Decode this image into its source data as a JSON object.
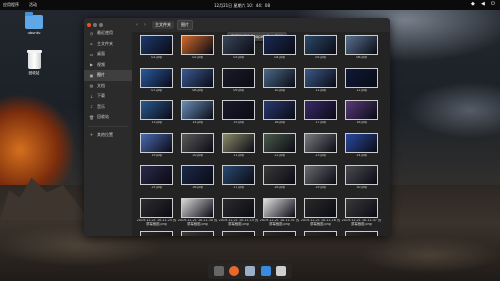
{
  "topbar": {
    "apps_menu": "应用程序",
    "activities": "活动",
    "clock": "12月21日 星期六 10：44：08"
  },
  "desktop": {
    "home_label": "ubuntu",
    "trash_label": "回收站"
  },
  "window": {
    "breadcrumb_home": "主文件夹",
    "breadcrumb_current": "图片",
    "toast_text": "已删除\"Wallpapers\"",
    "toast_undo": "撤消"
  },
  "sidebar": {
    "items": [
      {
        "icon": "clock-icon",
        "label": "最近使用"
      },
      {
        "icon": "home-icon",
        "label": "主文件夹"
      },
      {
        "icon": "desktop-icon",
        "label": "桌面"
      },
      {
        "icon": "video-icon",
        "label": "视频"
      },
      {
        "icon": "image-icon",
        "label": "图片"
      },
      {
        "icon": "document-icon",
        "label": "文档"
      },
      {
        "icon": "download-icon",
        "label": "下载"
      },
      {
        "icon": "music-icon",
        "label": "音乐"
      },
      {
        "icon": "trash-icon",
        "label": "回收站"
      }
    ],
    "other_locations": "其他位置"
  },
  "files": [
    {
      "name": "01.jpg",
      "color": "#1d3a6e"
    },
    {
      "name": "02.jpg",
      "color": "#d06a2a"
    },
    {
      "name": "03.jpg",
      "color": "#3a4658"
    },
    {
      "name": "04.jpg",
      "color": "#1a2a52"
    },
    {
      "name": "05.jpg",
      "color": "#2a4a6a"
    },
    {
      "name": "06.jpg",
      "color": "#5a7290"
    },
    {
      "name": "07.jpg",
      "color": "#2a5aa0"
    },
    {
      "name": "08.jpg",
      "color": "#3a5a92"
    },
    {
      "name": "09.jpg",
      "color": "#1c1c2a"
    },
    {
      "name": "10.jpg",
      "color": "#4a6a88"
    },
    {
      "name": "11.jpg",
      "color": "#3a5a88"
    },
    {
      "name": "12.jpg",
      "color": "#0e1a3a"
    },
    {
      "name": "13.jpg",
      "color": "#2a5a90"
    },
    {
      "name": "14.jpg",
      "color": "#6a8eb8"
    },
    {
      "name": "15.jpg",
      "color": "#1a1a2a"
    },
    {
      "name": "16.jpg",
      "color": "#2a3a70"
    },
    {
      "name": "17.jpg",
      "color": "#3a2a6a"
    },
    {
      "name": "18.jpg",
      "color": "#5a3a7a"
    },
    {
      "name": "19.jpg",
      "color": "#4a6ab0"
    },
    {
      "name": "20.jpg",
      "color": "#5a5a5a"
    },
    {
      "name": "21.jpg",
      "color": "#8a8a6a"
    },
    {
      "name": "22.jpg",
      "color": "#4a5a4a"
    },
    {
      "name": "23.jpg",
      "color": "#7a7a80"
    },
    {
      "name": "24.jpg",
      "color": "#2a4aa0"
    },
    {
      "name": "25.jpg",
      "color": "#2a2a4a"
    },
    {
      "name": "26.jpg",
      "color": "#1a2a4a"
    },
    {
      "name": "27.jpg",
      "color": "#2a4a70"
    },
    {
      "name": "28.jpg",
      "color": "#3a3a3a"
    },
    {
      "name": "29.jpg",
      "color": "#6a6a70"
    },
    {
      "name": "30.jpg",
      "color": "#4a4a50"
    },
    {
      "name": "2019-12-21 10-11-24 的屏幕截图.png",
      "color": "#2e2e2e"
    },
    {
      "name": "2019-12-21 10-11-30 的屏幕截图.png",
      "color": "#d8d8d8"
    },
    {
      "name": "2019-12-21 10-11-14 的屏幕截图.png",
      "color": "#2c2c2c"
    },
    {
      "name": "2019-12-21 10-11-51 的屏幕截图.png",
      "color": "#e0e0e0"
    },
    {
      "name": "2019-12-21 10-11-16 的屏幕截图.png",
      "color": "#2a2a2a"
    },
    {
      "name": "2019-12-21 10-11-47 的屏幕截图.png",
      "color": "#3a3a3a"
    },
    {
      "name": "",
      "color": "#2a2a2a"
    },
    {
      "name": "",
      "color": "#3a3a3a"
    },
    {
      "name": "",
      "color": "#2a2a2a"
    },
    {
      "name": "",
      "color": "#2a2a2a"
    },
    {
      "name": "",
      "color": "#2a2a2a"
    },
    {
      "name": "",
      "color": "#2a2a2a"
    }
  ],
  "dock": [
    {
      "icon": "app-grid-icon",
      "color": "#666666"
    },
    {
      "icon": "firefox-icon",
      "color": "#e8682a"
    },
    {
      "icon": "files-icon",
      "color": "#9ab0c8"
    },
    {
      "icon": "app-store-icon",
      "color": "#3a8ae0"
    },
    {
      "icon": "camera-icon",
      "color": "#cfcfcf"
    }
  ]
}
